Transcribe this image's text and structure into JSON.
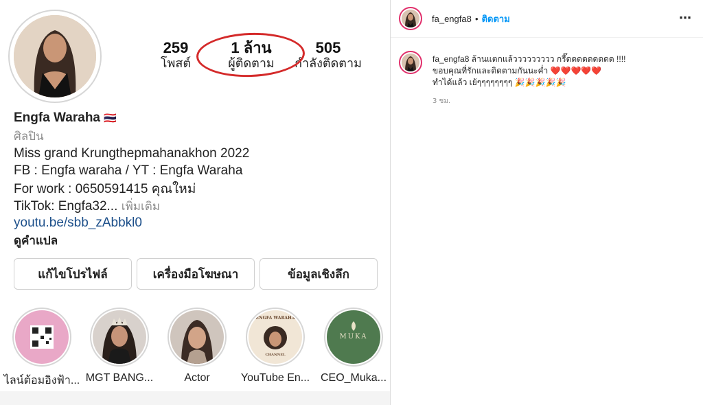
{
  "profile": {
    "stats": [
      {
        "value": "259",
        "label": "โพสต์"
      },
      {
        "value": "1 ล้าน",
        "label": "ผู้ติดตาม"
      },
      {
        "value": "505",
        "label": "กำลังติดตาม"
      }
    ],
    "name": "Engfa Waraha",
    "flag": "🇹🇭",
    "category": "ศิลปิน",
    "bio_lines": [
      "Miss grand Krungthepmahanakhon 2022",
      "FB : Engfa waraha / YT : Engfa Waraha",
      "For work : 0650591415 คุณใหม่"
    ],
    "tiktok": "TikTok: Engfa32...",
    "more": " เพิ่มเติม",
    "link": "youtu.be/sbb_zAbbkl0",
    "translate": "ดูคำแปล",
    "buttons": [
      "แก้ไขโปรไฟล์",
      "เครื่องมือโฆษณา",
      "ข้อมูลเชิงลึก"
    ],
    "highlights": [
      {
        "caption": "ไลน์ต้อมอิงฟ้า..."
      },
      {
        "caption": "MGT BANG..."
      },
      {
        "caption": "Actor"
      },
      {
        "caption": "YouTube En..."
      },
      {
        "caption": "CEO_Muka..."
      }
    ],
    "highlight_texts": {
      "engfa": "ENGFA WARAHA",
      "channel": "CHANNEL",
      "muka": "MUKA"
    }
  },
  "post": {
    "username": "fa_engfa8",
    "dot": "•",
    "follow": "ติดตาม",
    "more_icon": "⋯",
    "caption_user": "fa_engfa8",
    "caption_line1": " ล้านแตกแล้ววววววววว กรี๊ดดดดดดดดด !!!!",
    "caption_line2": "ขอบคุณที่รักและติดตามกันนะค่ำ",
    "caption_line3": "ทำได้แล้ว เย้ๆๆๆๆๆๆๆๆ",
    "hearts": "❤️❤️❤️❤️❤️",
    "party": "🎉🎉🎉🎉🎉",
    "time": "3 ชม."
  },
  "colors": {
    "accent": "#0095f6",
    "circle": "#d42a2a",
    "link": "#1c4f8a"
  }
}
